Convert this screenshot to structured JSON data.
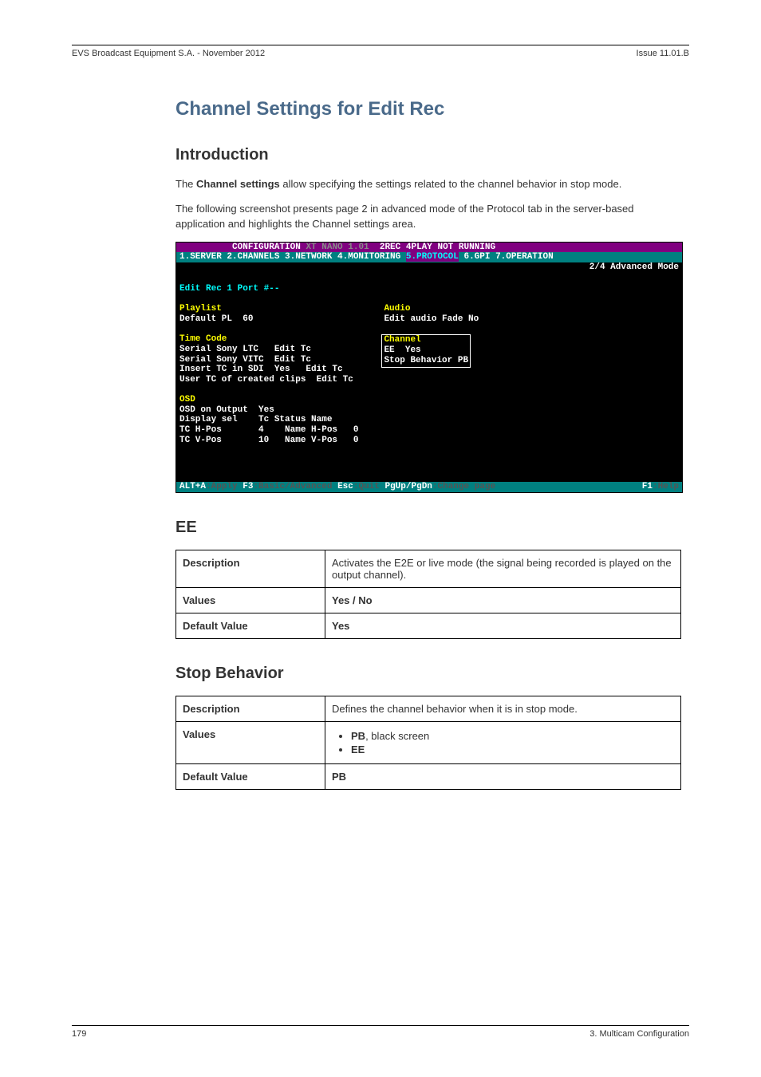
{
  "header": {
    "left": "EVS Broadcast Equipment S.A. - November 2012",
    "right": "Issue 11.01.B"
  },
  "title": "Channel Settings for Edit Rec",
  "intro": {
    "heading": "Introduction",
    "p1_pre": "The ",
    "p1_bold": "Channel settings",
    "p1_post": " allow specifying the settings related to the channel behavior in stop mode.",
    "p2": "The following screenshot presents page 2 in advanced mode of the Protocol tab in the server-based application and highlights the Channel settings area."
  },
  "shot": {
    "bar_left": "          CONFIGURATION ",
    "bar_mid": "XT NANO 1.01  ",
    "bar_right": "2REC 4PLAY NOT RUNNING",
    "tabs_line": "1.SERVER 2.CHANNELS 3.NETWORK 4.MONITORING ",
    "tab_active": "5.PROTOCOL",
    "tabs_rest": " 6.GPI 7.OPERATION",
    "mode": "2/4 Advanced Mode",
    "edit_port": "Edit Rec 1 Port #--",
    "playlist_h": "Playlist",
    "playlist_v": "Default PL  60",
    "tc_h": "Time Code",
    "tc1": "Serial Sony LTC   Edit Tc",
    "tc2": "Serial Sony VITC  Edit Tc",
    "tc3": "Insert TC in SDI  Yes   Edit Tc",
    "tc4": "User TC of created clips  Edit Tc",
    "osd_h": "OSD",
    "osd1": "OSD on Output  Yes",
    "osd2": "Display sel    Tc Status Name",
    "osd3": "TC H-Pos       4    Name H-Pos   0",
    "osd4": "TC V-Pos       10   Name V-Pos   0",
    "audio_h": "Audio",
    "audio_v": "Edit audio Fade No",
    "chan_h": "Channel",
    "chan1": "EE  Yes",
    "chan2": "Stop Behavior PB",
    "foot_alt": "ALT+A",
    "foot_apply": ":Apply ",
    "foot_f3": "F3",
    "foot_basic": ":Basic/Advanced ",
    "foot_esc": "Esc",
    "foot_quit": ":Quit ",
    "foot_pg": "PgUp/PgDn",
    "foot_chg": ":Change page",
    "foot_f1": "F1",
    "foot_help": ":Help"
  },
  "ee": {
    "heading": "EE",
    "desc_label": "Description",
    "desc_val": "Activates the E2E or live mode (the signal being recorded is played on the output channel).",
    "values_label": "Values",
    "values_val": "Yes / No",
    "def_label": "Default Value",
    "def_val": "Yes"
  },
  "stop": {
    "heading": "Stop Behavior",
    "desc_label": "Description",
    "desc_val": "Defines the channel behavior when it is in stop mode.",
    "values_label": "Values",
    "v1_bold": "PB",
    "v1_rest": ", black screen",
    "v2": "EE",
    "def_label": "Default Value",
    "def_val": "PB"
  },
  "footer": {
    "left": "179",
    "right": "3. Multicam Configuration"
  }
}
